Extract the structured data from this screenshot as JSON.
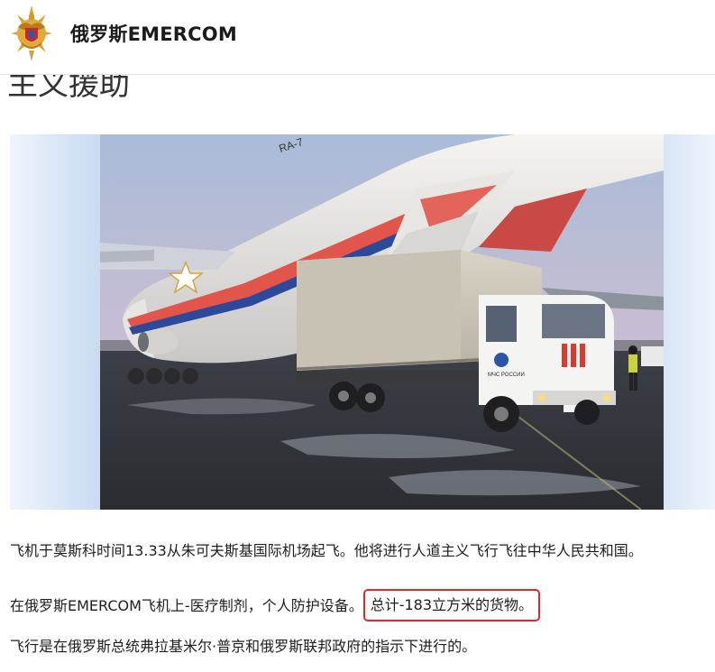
{
  "header": {
    "site_title": "俄罗斯EMERCOM",
    "logo_icon": "emercom-emblem-icon",
    "colors": {
      "emblem_gold": "#d39a2a",
      "emblem_red": "#c8282a",
      "emblem_blue": "#2a5aa8"
    }
  },
  "article": {
    "heading_visible_fragment": "主义援助",
    "photo": {
      "aircraft_icon": "cargo-aircraft-image",
      "truck_icon": "emercom-truck-image",
      "tail_marking": "RA-7",
      "truck_door_text": "МЧС РОССИИ"
    },
    "paragraphs": {
      "p1": "飞机于莫斯科时间13.33从朱可夫斯基国际机场起飞。他将进行人道主义飞行飞往中华人民共和国。",
      "p2_prefix": "在俄罗斯EMERCOM飞机上-医疗制剂，个人防护设备。",
      "p2_highlight": "总计-183立方米的货物。",
      "p3": "飞行是在俄罗斯总统弗拉基米尔·普京和俄罗斯联邦政府的指示下进行的。"
    },
    "highlight_color": "#e3262b"
  }
}
